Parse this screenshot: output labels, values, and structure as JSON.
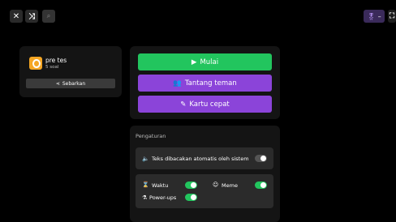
{
  "topbar": {
    "close_icon": "close-icon",
    "shuffle_icon": "shuffle-icon",
    "search_icon": "search-icon",
    "badge_text": "–",
    "fullscreen_icon": "fullscreen-icon"
  },
  "quiz": {
    "title": "pre tes",
    "subtitle": "5 soal",
    "share_label": "Sebarkan"
  },
  "actions": {
    "start_label": "Mulai",
    "challenge_label": "Tantang teman",
    "flashcard_label": "Kartu cepat"
  },
  "settings": {
    "heading": "Pengaturan",
    "auto_read_label": "Teks dibacakan atomatis oleh sistem",
    "time_label": "Waktu",
    "meme_label": "Meme",
    "powerups_label": "Power-ups",
    "auto_read_on": false,
    "time_on": true,
    "meme_on": true,
    "powerups_on": true
  },
  "colors": {
    "start": "#22c55e",
    "purple": "#8b44d9",
    "badge": "#7c3aed",
    "quiz_icon": "#f5a623"
  }
}
